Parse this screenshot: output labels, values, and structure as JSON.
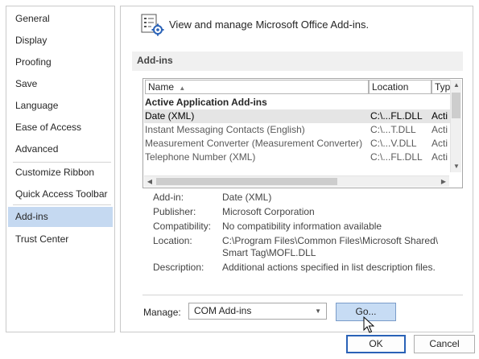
{
  "nav": {
    "items": [
      {
        "label": "General"
      },
      {
        "label": "Display"
      },
      {
        "label": "Proofing"
      },
      {
        "label": "Save"
      },
      {
        "label": "Language"
      },
      {
        "label": "Ease of Access"
      },
      {
        "label": "Advanced"
      },
      {
        "label": "Customize Ribbon"
      },
      {
        "label": "Quick Access Toolbar"
      },
      {
        "label": "Add-ins"
      },
      {
        "label": "Trust Center"
      }
    ],
    "selected": "Add-ins"
  },
  "header": {
    "icon": "addins-settings-icon",
    "title": "View and manage Microsoft Office Add-ins."
  },
  "section": {
    "title": "Add-ins"
  },
  "list": {
    "columns": [
      "Name",
      "Location",
      "Typ"
    ],
    "group": "Active Application Add-ins",
    "rows": [
      {
        "name": "Date (XML)",
        "location": "C:\\...FL.DLL",
        "type": "Acti"
      },
      {
        "name": "Instant Messaging Contacts (English)",
        "location": "C:\\...T.DLL",
        "type": "Acti"
      },
      {
        "name": "Measurement Converter (Measurement Converter)",
        "location": "C:\\...V.DLL",
        "type": "Acti"
      },
      {
        "name": "Telephone Number (XML)",
        "location": "C:\\...FL.DLL",
        "type": "Acti"
      }
    ],
    "selected_row": 0
  },
  "details": {
    "addin_label": "Add-in:",
    "addin_value": "Date (XML)",
    "publisher_label": "Publisher:",
    "publisher_value": "Microsoft Corporation",
    "compat_label": "Compatibility:",
    "compat_value": "No compatibility information available",
    "location_label": "Location:",
    "location_value_1": "C:\\Program Files\\Common Files\\Microsoft Shared\\",
    "location_value_2": "Smart Tag\\MOFL.DLL",
    "description_label": "Description:",
    "description_value": "Additional actions specified in list description files."
  },
  "manage": {
    "label": "Manage:",
    "selected": "COM Add-ins",
    "go_label": "Go..."
  },
  "footer": {
    "ok_label": "OK",
    "cancel_label": "Cancel"
  },
  "colors": {
    "selected_nav": "#c5d9f1",
    "go_button": "#c7dcf4",
    "primary_border": "#2a62b7"
  }
}
